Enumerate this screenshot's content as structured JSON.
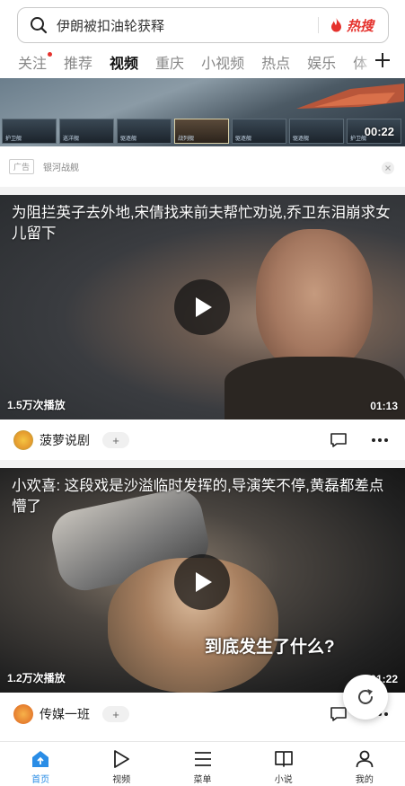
{
  "search": {
    "query": "伊朗被扣油轮获释",
    "hot_label": "热搜"
  },
  "tabs": [
    {
      "label": "关注"
    },
    {
      "label": "推荐"
    },
    {
      "label": "视频"
    },
    {
      "label": "重庆"
    },
    {
      "label": "小视频"
    },
    {
      "label": "热点"
    },
    {
      "label": "娱乐"
    },
    {
      "label": "体"
    }
  ],
  "active_tab": "视频",
  "ad": {
    "tag": "广告",
    "name": "银河战舰",
    "duration": "00:22",
    "card_labels": [
      "护卫舰",
      "巡洋舰",
      "驱逐舰",
      "战列舰",
      "驱逐舰",
      "驱逐舰",
      "护卫舰"
    ]
  },
  "videos": [
    {
      "title": "为阻拦英子去外地,宋倩找来前夫帮忙劝说,乔卫东泪崩求女儿留下",
      "plays": "1.5万次播放",
      "duration": "01:13",
      "author": "菠萝说剧"
    },
    {
      "title": "小欢喜: 这段戏是沙溢临时发挥的,导演笑不停,黄磊都差点懵了",
      "plays": "1.2万次播放",
      "duration": "01:22",
      "caption": "到底发生了什么?",
      "author": "传媒一班"
    }
  ],
  "follow_label": "+",
  "bottom_nav": [
    {
      "label": "首页",
      "icon": "home-icon"
    },
    {
      "label": "视频",
      "icon": "play-icon"
    },
    {
      "label": "菜单",
      "icon": "menu-icon"
    },
    {
      "label": "小说",
      "icon": "book-icon"
    },
    {
      "label": "我的",
      "icon": "user-icon"
    }
  ],
  "colors": {
    "accent": "#2a8de6",
    "hot": "#e5322d"
  }
}
